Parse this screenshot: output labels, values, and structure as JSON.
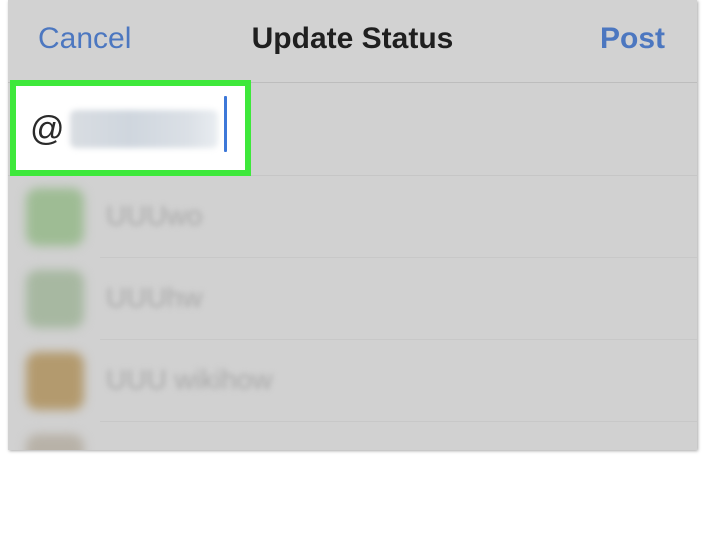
{
  "navbar": {
    "cancel_label": "Cancel",
    "title": "Update Status",
    "post_label": "Post"
  },
  "compose": {
    "prefix": "@"
  },
  "suggestions": [
    {
      "name": "UUUwo",
      "avatar_color": "#9ebc94"
    },
    {
      "name": "UUUhw",
      "avatar_color": "#a7b8a1"
    },
    {
      "name": "UUU wikihow",
      "avatar_color": "#b39a6e"
    },
    {
      "name": "",
      "avatar_color": "#b8b2a8"
    }
  ],
  "colors": {
    "accent": "#4c77c0",
    "highlight": "#3ee83b",
    "screen_bg": "#d1d1d1"
  }
}
